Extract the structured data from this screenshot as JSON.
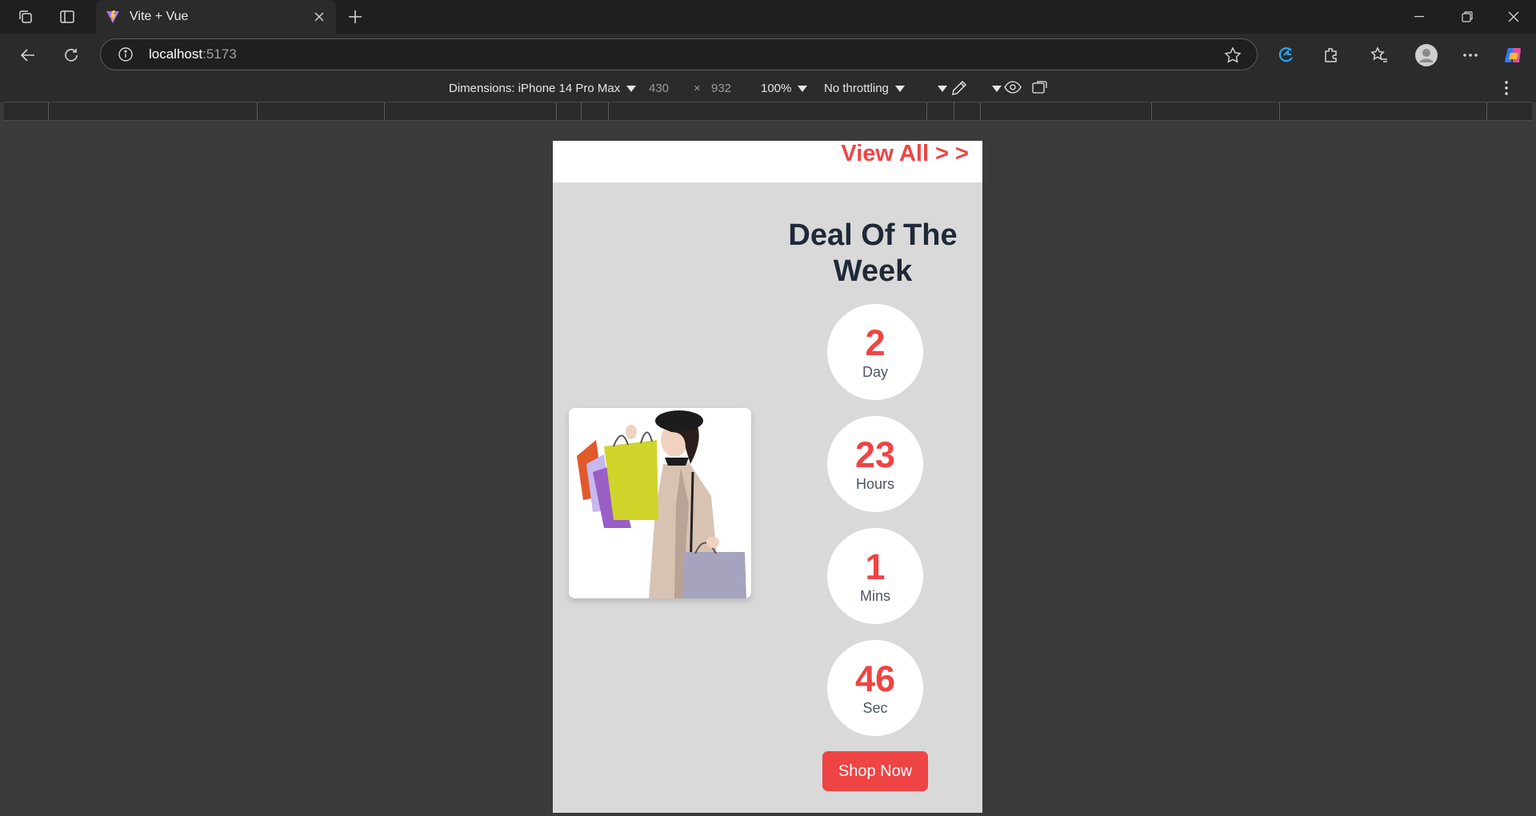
{
  "tab": {
    "title": "Vite + Vue"
  },
  "address": {
    "host": "localhost",
    "port": ":5173"
  },
  "devtools": {
    "device_label": "Dimensions: iPhone 14 Pro Max",
    "width": "430",
    "times": "×",
    "height": "932",
    "zoom": "100%",
    "throttling": "No throttling"
  },
  "page": {
    "view_all": "View All > >",
    "title": "Deal Of The Week",
    "countdown": [
      {
        "value": "2",
        "unit": "Day"
      },
      {
        "value": "23",
        "unit": "Hours"
      },
      {
        "value": "1",
        "unit": "Mins"
      },
      {
        "value": "46",
        "unit": "Sec"
      }
    ],
    "shop_button": "Shop Now"
  },
  "colors": {
    "accent": "#ef4444",
    "heading": "#1f2937",
    "panel": "#d9d9d9"
  }
}
